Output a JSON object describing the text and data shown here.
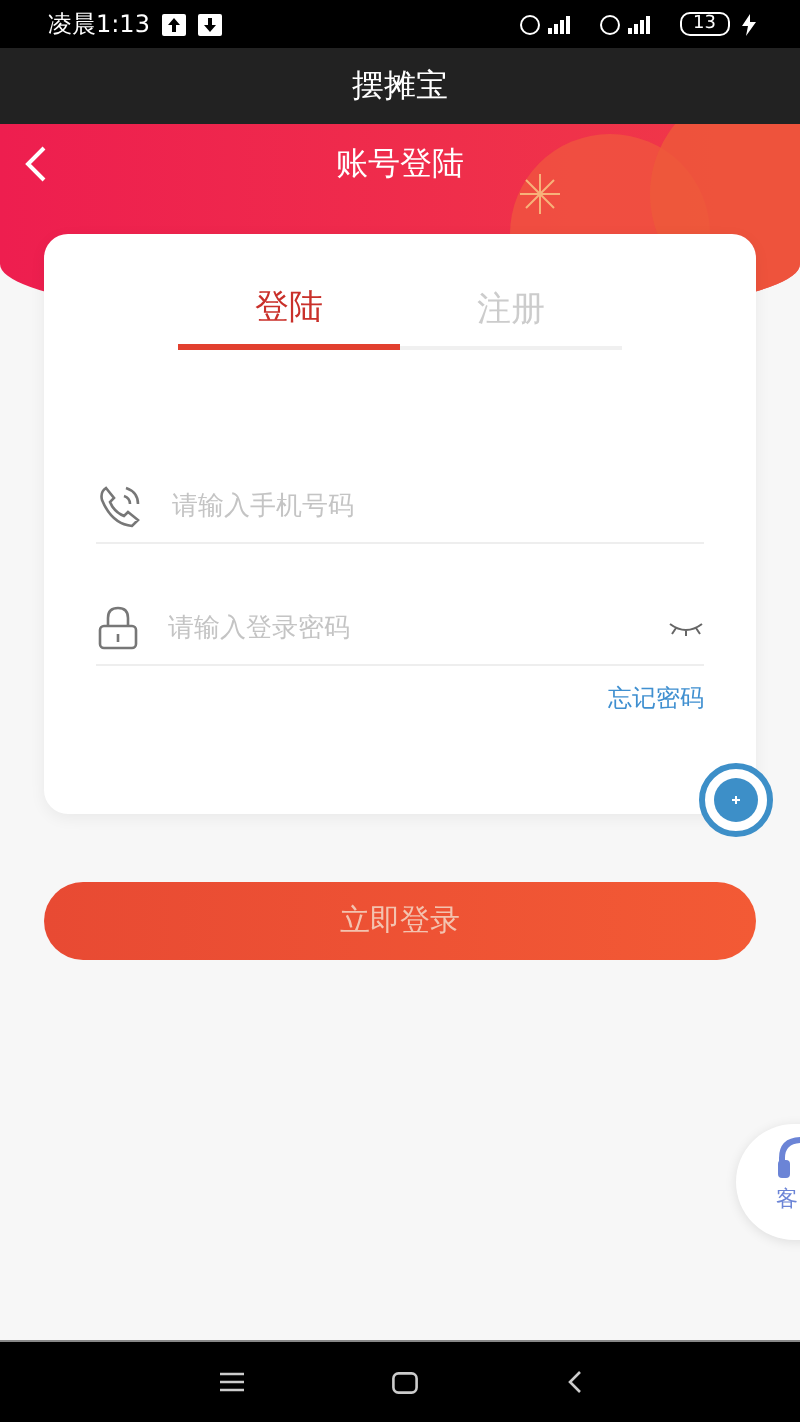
{
  "status_bar": {
    "time": "凌晨1:13",
    "battery": "13"
  },
  "app_bar": {
    "title": "摆摊宝"
  },
  "header": {
    "title": "账号登陆"
  },
  "tabs": [
    {
      "label": "登陆",
      "selected": true
    },
    {
      "label": "注册",
      "selected": false
    }
  ],
  "fields": [
    {
      "kind": "phone",
      "placeholder": "请输入手机号码"
    },
    {
      "kind": "password",
      "placeholder": "请输入登录密码"
    }
  ],
  "forgot_link": "忘记密码",
  "login_button": "立即登录",
  "service_button": {
    "label": "客"
  }
}
